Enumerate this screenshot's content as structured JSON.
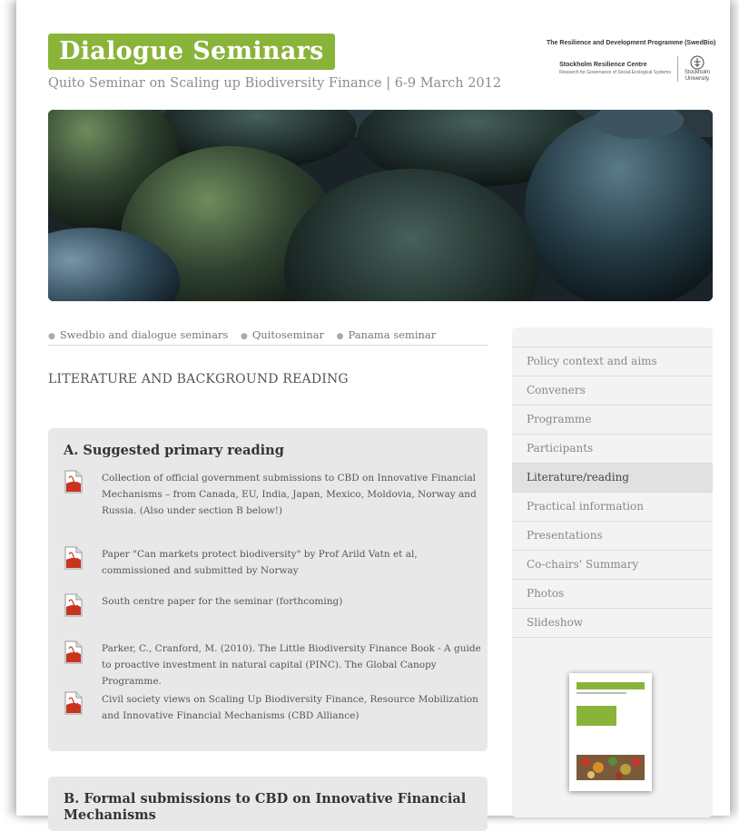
{
  "header": {
    "logo_text": "Dialogue Seminars",
    "subtitle": "Quito Seminar on Scaling up Biodiversity Finance | 6-9 March 2012",
    "programme_name": "The Resilience and Development Programme (SwedBio)",
    "partner_src_name": "Stockholm Resilience Centre",
    "partner_src_tagline": "Research for Governance of Social-Ecological Systems",
    "partner_su_name_1": "Stockholm",
    "partner_su_name_2": "University"
  },
  "breadcrumb": {
    "items": [
      "Swedbio and dialogue seminars",
      "Quitoseminar",
      "Panama seminar"
    ]
  },
  "page_title": "LITERATURE AND BACKGROUND READING",
  "section_a": {
    "heading": "A. Suggested primary reading",
    "items": [
      "Collection of official government submissions to CBD on Innovative Financial Mechanisms – from Canada, EU, India, Japan, Mexico, Moldovia, Norway and Russia. (Also under section B below!)",
      "Paper \"Can markets protect biodiversity\" by Prof Arild Vatn et al, commissioned and submitted by Norway",
      "South centre paper for the seminar (forthcoming)",
      "Parker, C., Cranford, M. (2010). The Little Biodiversity Finance Book - A guide to proactive investment in natural capital (PINC). The Global Canopy Programme.",
      "Civil society views on Scaling Up Biodiversity Finance, Resource Mobilization and Innovative Financial Mechanisms (CBD Alliance)"
    ]
  },
  "section_b": {
    "heading": "B. Formal submissions to CBD on Innovative Financial Mechanisms"
  },
  "side_menu": {
    "items": [
      "Policy context and aims",
      "Conveners",
      "Programme",
      "Participants",
      "Literature/reading",
      "Practical information",
      "Presentations",
      "Co-chairs' Summary",
      "Photos",
      "Slideshow"
    ],
    "active_index": 4
  },
  "icons": {
    "document": "pdf-icon"
  },
  "colors": {
    "brand_green": "#8ab33a",
    "pdf_red": "#c8341e"
  }
}
